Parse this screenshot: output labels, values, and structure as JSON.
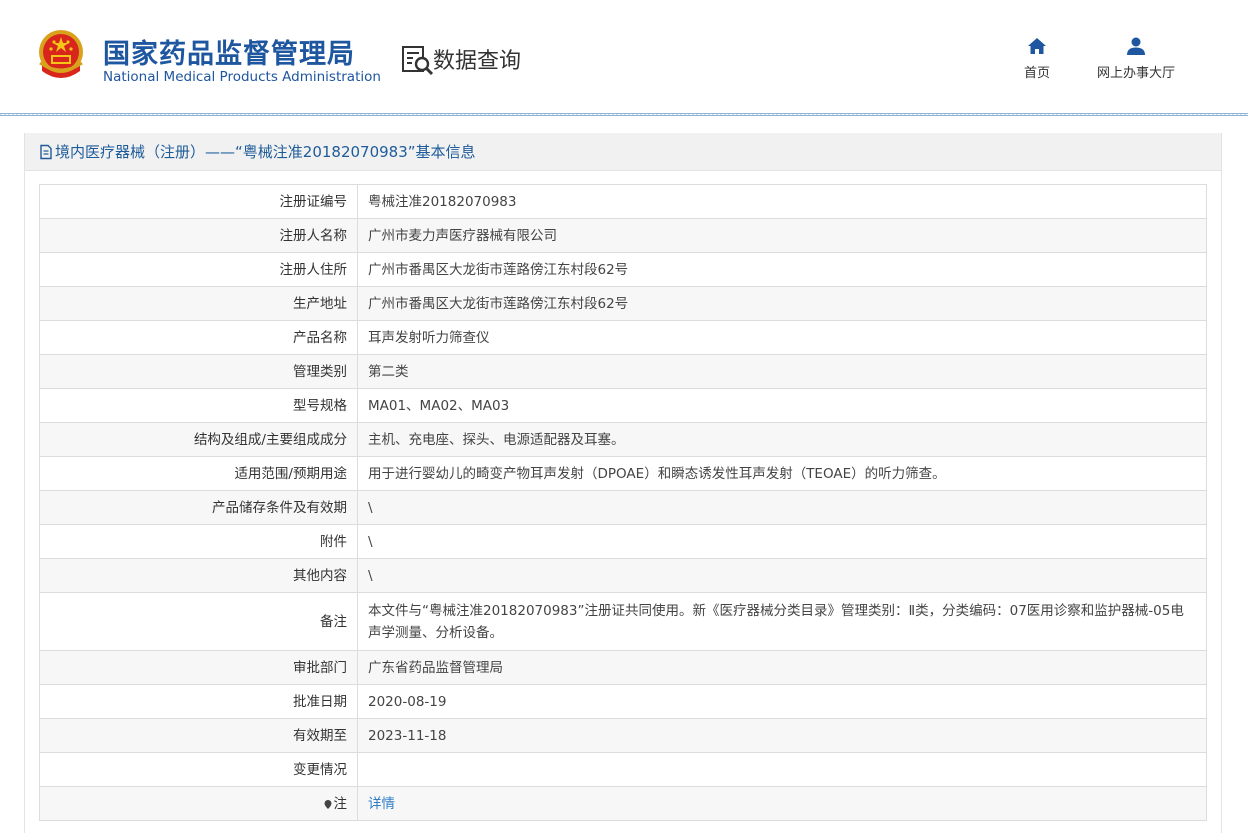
{
  "header": {
    "org_cn": "国家药品监督管理局",
    "org_en": "National Medical Products Administration",
    "query_label": "数据查询",
    "nav": [
      {
        "label": "首页",
        "icon": "home-icon"
      },
      {
        "label": "网上办事大厅",
        "icon": "user-icon"
      }
    ],
    "brand_color": "#1e56a0"
  },
  "panel": {
    "title": "境内医疗器械（注册）——“粤械注准20182070983”基本信息"
  },
  "rows": [
    {
      "label": "注册证编号",
      "value": "粤械注准20182070983"
    },
    {
      "label": "注册人名称",
      "value": "广州市麦力声医疗器械有限公司"
    },
    {
      "label": "注册人住所",
      "value": "广州市番禺区大龙街市莲路傍江东村段62号"
    },
    {
      "label": "生产地址",
      "value": "广州市番禺区大龙街市莲路傍江东村段62号"
    },
    {
      "label": "产品名称",
      "value": "耳声发射听力筛查仪"
    },
    {
      "label": "管理类别",
      "value": "第二类"
    },
    {
      "label": "型号规格",
      "value": "MA01、MA02、MA03"
    },
    {
      "label": "结构及组成/主要组成成分",
      "value": "主机、充电座、探头、电源适配器及耳塞。"
    },
    {
      "label": "适用范围/预期用途",
      "value": "用于进行婴幼儿的畸变产物耳声发射（DPOAE）和瞬态诱发性耳声发射（TEOAE）的听力筛查。"
    },
    {
      "label": "产品储存条件及有效期",
      "value": "\\"
    },
    {
      "label": "附件",
      "value": "\\"
    },
    {
      "label": "其他内容",
      "value": "\\"
    },
    {
      "label": "备注",
      "value": "本文件与“粤械注准20182070983”注册证共同使用。新《医疗器械分类目录》管理类别：Ⅱ类，分类编码：07医用诊察和监护器械-05电声学测量、分析设备。"
    },
    {
      "label": "审批部门",
      "value": "广东省药品监督管理局"
    },
    {
      "label": "批准日期",
      "value": "2020-08-19"
    },
    {
      "label": "有效期至",
      "value": "2023-11-18"
    },
    {
      "label": "变更情况",
      "value": ""
    }
  ],
  "note_row": {
    "label": "注",
    "link": "详情"
  },
  "link_color": "#2d7cc8"
}
